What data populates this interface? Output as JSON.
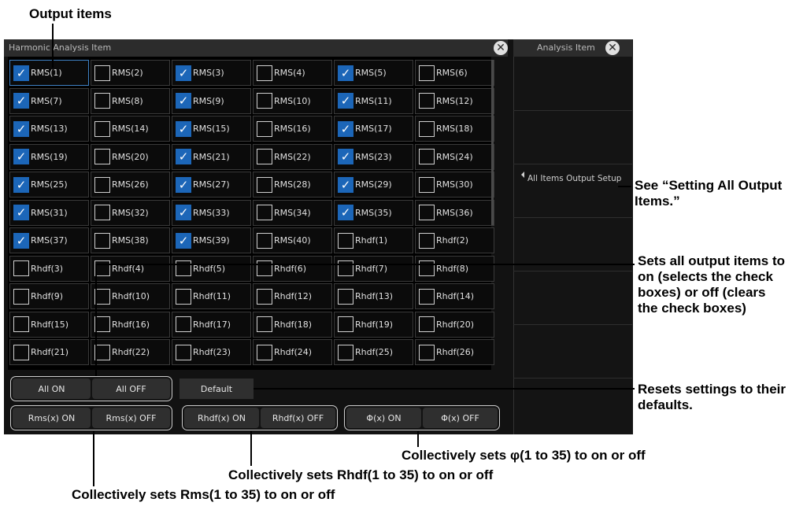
{
  "dialog": {
    "title": "Harmonic Analysis Item",
    "close_glyph": "✕",
    "items": [
      {
        "label": "RMS(1)",
        "checked": true
      },
      {
        "label": "RMS(2)",
        "checked": false
      },
      {
        "label": "RMS(3)",
        "checked": true
      },
      {
        "label": "RMS(4)",
        "checked": false
      },
      {
        "label": "RMS(5)",
        "checked": true
      },
      {
        "label": "RMS(6)",
        "checked": false
      },
      {
        "label": "RMS(7)",
        "checked": true
      },
      {
        "label": "RMS(8)",
        "checked": false
      },
      {
        "label": "RMS(9)",
        "checked": true
      },
      {
        "label": "RMS(10)",
        "checked": false
      },
      {
        "label": "RMS(11)",
        "checked": true
      },
      {
        "label": "RMS(12)",
        "checked": false
      },
      {
        "label": "RMS(13)",
        "checked": true
      },
      {
        "label": "RMS(14)",
        "checked": false
      },
      {
        "label": "RMS(15)",
        "checked": true
      },
      {
        "label": "RMS(16)",
        "checked": false
      },
      {
        "label": "RMS(17)",
        "checked": true
      },
      {
        "label": "RMS(18)",
        "checked": false
      },
      {
        "label": "RMS(19)",
        "checked": true
      },
      {
        "label": "RMS(20)",
        "checked": false
      },
      {
        "label": "RMS(21)",
        "checked": true
      },
      {
        "label": "RMS(22)",
        "checked": false
      },
      {
        "label": "RMS(23)",
        "checked": true
      },
      {
        "label": "RMS(24)",
        "checked": false
      },
      {
        "label": "RMS(25)",
        "checked": true
      },
      {
        "label": "RMS(26)",
        "checked": false
      },
      {
        "label": "RMS(27)",
        "checked": true
      },
      {
        "label": "RMS(28)",
        "checked": false
      },
      {
        "label": "RMS(29)",
        "checked": true
      },
      {
        "label": "RMS(30)",
        "checked": false
      },
      {
        "label": "RMS(31)",
        "checked": true
      },
      {
        "label": "RMS(32)",
        "checked": false
      },
      {
        "label": "RMS(33)",
        "checked": true
      },
      {
        "label": "RMS(34)",
        "checked": false
      },
      {
        "label": "RMS(35)",
        "checked": true
      },
      {
        "label": "RMS(36)",
        "checked": false
      },
      {
        "label": "RMS(37)",
        "checked": true
      },
      {
        "label": "RMS(38)",
        "checked": false
      },
      {
        "label": "RMS(39)",
        "checked": true
      },
      {
        "label": "RMS(40)",
        "checked": false
      },
      {
        "label": "Rhdf(1)",
        "checked": false
      },
      {
        "label": "Rhdf(2)",
        "checked": false
      },
      {
        "label": "Rhdf(3)",
        "checked": false
      },
      {
        "label": "Rhdf(4)",
        "checked": false
      },
      {
        "label": "Rhdf(5)",
        "checked": false
      },
      {
        "label": "Rhdf(6)",
        "checked": false
      },
      {
        "label": "Rhdf(7)",
        "checked": false
      },
      {
        "label": "Rhdf(8)",
        "checked": false
      },
      {
        "label": "Rhdf(9)",
        "checked": false
      },
      {
        "label": "Rhdf(10)",
        "checked": false
      },
      {
        "label": "Rhdf(11)",
        "checked": false
      },
      {
        "label": "Rhdf(12)",
        "checked": false
      },
      {
        "label": "Rhdf(13)",
        "checked": false
      },
      {
        "label": "Rhdf(14)",
        "checked": false
      },
      {
        "label": "Rhdf(15)",
        "checked": false
      },
      {
        "label": "Rhdf(16)",
        "checked": false
      },
      {
        "label": "Rhdf(17)",
        "checked": false
      },
      {
        "label": "Rhdf(18)",
        "checked": false
      },
      {
        "label": "Rhdf(19)",
        "checked": false
      },
      {
        "label": "Rhdf(20)",
        "checked": false
      },
      {
        "label": "Rhdf(21)",
        "checked": false
      },
      {
        "label": "Rhdf(22)",
        "checked": false
      },
      {
        "label": "Rhdf(23)",
        "checked": false
      },
      {
        "label": "Rhdf(24)",
        "checked": false
      },
      {
        "label": "Rhdf(25)",
        "checked": false
      },
      {
        "label": "Rhdf(26)",
        "checked": false
      }
    ],
    "buttons": {
      "all_on": "All ON",
      "all_off": "All OFF",
      "default": "Default",
      "rms_on": "Rms(x) ON",
      "rms_off": "Rms(x) OFF",
      "rhdf_on": "Rhdf(x) ON",
      "rhdf_off": "Rhdf(x) OFF",
      "phi_on": "Φ(x) ON",
      "phi_off": "Φ(x) OFF"
    }
  },
  "side_panel": {
    "title": "Analysis Item",
    "all_items": "All Items Output Setup"
  },
  "annotations": {
    "output_items": "Output items",
    "see_setting": "See “Setting All Output Items.”",
    "sets_all": "Sets all output items to on (selects the check boxes) or off (clears the check boxes)",
    "resets": "Resets settings to their defaults.",
    "phi": "Collectively sets φ(1 to 35) to on or off",
    "rhdf": "Collectively sets Rhdf(1 to 35) to on or off",
    "rms": "Collectively sets Rms(1 to 35) to on or off"
  }
}
